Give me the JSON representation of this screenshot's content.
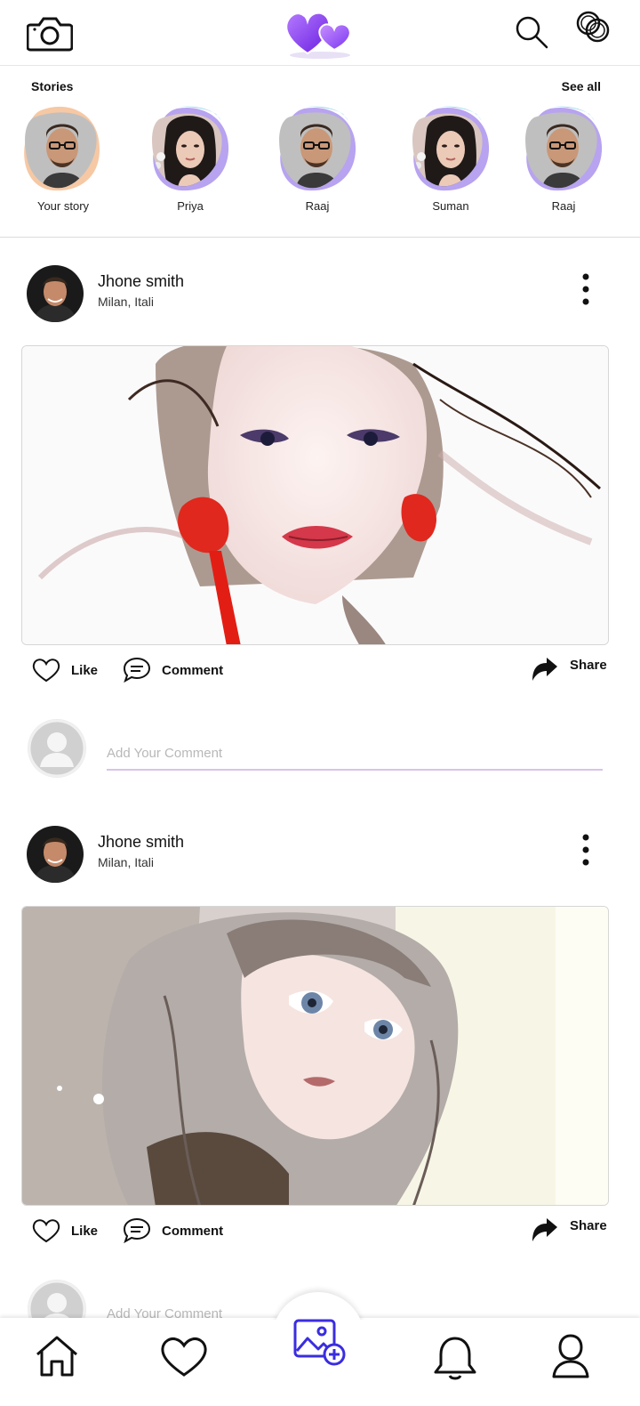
{
  "topbar": {
    "camera_icon": "camera-icon",
    "logo_icon": "two-hearts-logo",
    "search_icon": "search-icon",
    "rings_icon": "rings-icon",
    "brand_gradient": [
      "#7a36f0",
      "#c27bff"
    ]
  },
  "stories": {
    "title": "Stories",
    "see_all": "See all",
    "items": [
      {
        "name": "Your story",
        "blob_color": "#f6c8a4",
        "avatar": "man-glasses"
      },
      {
        "name": "Priya",
        "blob_color": "#b7a3f0",
        "avatar": "woman-dark-hair"
      },
      {
        "name": "Raaj",
        "blob_color": "#b7a3f0",
        "avatar": "man-glasses"
      },
      {
        "name": "Suman",
        "blob_color": "#b7a3f0",
        "avatar": "woman-dark-hair"
      },
      {
        "name": "Raaj",
        "blob_color": "#b7a3f0",
        "avatar": "man-glasses"
      }
    ]
  },
  "posts": [
    {
      "author": "Jhone smith",
      "location": "Milan, Itali",
      "image": "watercolor-woman-red-flowers",
      "like_label": "Like",
      "comment_label": "Comment",
      "share_label": "Share",
      "comment_placeholder": "Add Your Comment"
    },
    {
      "author": "Jhone smith",
      "location": "Milan, Itali",
      "image": "anime-girl-grey-hair",
      "like_label": "Like",
      "comment_label": "Comment",
      "share_label": "Share",
      "comment_placeholder": "Add Your Comment"
    }
  ],
  "bottom_nav": {
    "items": [
      "home-icon",
      "heart-icon",
      "add-photo-icon",
      "bell-icon",
      "profile-icon"
    ],
    "accent": "#3a2de0"
  }
}
